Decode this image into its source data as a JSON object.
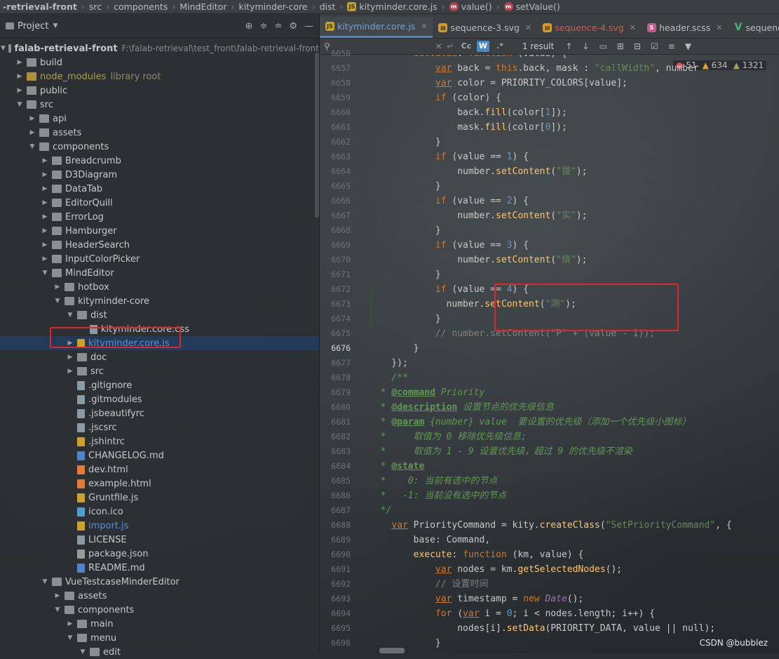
{
  "breadcrumb": [
    "-retrieval-front",
    "src",
    "components",
    "MindEditor",
    "kityminder-core",
    "dist",
    "kityminder.core.js",
    "value()",
    "setValue()"
  ],
  "project": {
    "title": "Project",
    "rows": [
      {
        "indent": 0,
        "arrow": "down",
        "icon": "folder",
        "label": "falab-retrieval-front",
        "path": "F:\\falab-retrieval\\test_front\\falab-retrieval-front",
        "bold": true
      },
      {
        "indent": 1,
        "arrow": "right",
        "icon": "folder",
        "label": "build"
      },
      {
        "indent": 1,
        "arrow": "right",
        "icon": "folder-lib",
        "label": "node_modules",
        "note": "library root",
        "style": "yellow"
      },
      {
        "indent": 1,
        "arrow": "right",
        "icon": "folder",
        "label": "public"
      },
      {
        "indent": 1,
        "arrow": "down",
        "icon": "folder",
        "label": "src"
      },
      {
        "indent": 2,
        "arrow": "right",
        "icon": "folder",
        "label": "api"
      },
      {
        "indent": 2,
        "arrow": "right",
        "icon": "folder",
        "label": "assets"
      },
      {
        "indent": 2,
        "arrow": "down",
        "icon": "folder",
        "label": "components"
      },
      {
        "indent": 3,
        "arrow": "right",
        "icon": "folder",
        "label": "Breadcrumb"
      },
      {
        "indent": 3,
        "arrow": "right",
        "icon": "folder",
        "label": "D3Diagram"
      },
      {
        "indent": 3,
        "arrow": "right",
        "icon": "folder",
        "label": "DataTab"
      },
      {
        "indent": 3,
        "arrow": "right",
        "icon": "folder",
        "label": "EditorQuill"
      },
      {
        "indent": 3,
        "arrow": "right",
        "icon": "folder",
        "label": "ErrorLog"
      },
      {
        "indent": 3,
        "arrow": "right",
        "icon": "folder",
        "label": "Hamburger"
      },
      {
        "indent": 3,
        "arrow": "right",
        "icon": "folder",
        "label": "HeaderSearch"
      },
      {
        "indent": 3,
        "arrow": "right",
        "icon": "folder",
        "label": "InputColorPicker"
      },
      {
        "indent": 3,
        "arrow": "down",
        "icon": "folder",
        "label": "MindEditor"
      },
      {
        "indent": 4,
        "arrow": "right",
        "icon": "folder",
        "label": "hotbox"
      },
      {
        "indent": 4,
        "arrow": "down",
        "icon": "folder",
        "label": "kityminder-core"
      },
      {
        "indent": 5,
        "arrow": "down",
        "icon": "folder",
        "label": "dist"
      },
      {
        "indent": 6,
        "arrow": "",
        "icon": "file",
        "label": "kityminder.core.css"
      },
      {
        "indent": 5,
        "arrow": "right",
        "icon": "file-js",
        "label": "kityminder.core.js",
        "selected": true,
        "style": "blue"
      },
      {
        "indent": 5,
        "arrow": "right",
        "icon": "folder",
        "label": "doc"
      },
      {
        "indent": 5,
        "arrow": "right",
        "icon": "folder",
        "label": "src"
      },
      {
        "indent": 5,
        "arrow": "",
        "icon": "file",
        "label": ".gitignore"
      },
      {
        "indent": 5,
        "arrow": "",
        "icon": "file",
        "label": ".gitmodules"
      },
      {
        "indent": 5,
        "arrow": "",
        "icon": "file",
        "label": ".jsbeautifyrc"
      },
      {
        "indent": 5,
        "arrow": "",
        "icon": "file",
        "label": ".jscsrc"
      },
      {
        "indent": 5,
        "arrow": "",
        "icon": "file-js",
        "label": ".jshintrc"
      },
      {
        "indent": 5,
        "arrow": "",
        "icon": "file-md",
        "label": "CHANGELOG.md"
      },
      {
        "indent": 5,
        "arrow": "",
        "icon": "file-html",
        "label": "dev.html"
      },
      {
        "indent": 5,
        "arrow": "",
        "icon": "file-html",
        "label": "example.html"
      },
      {
        "indent": 5,
        "arrow": "",
        "icon": "file-js",
        "label": "Gruntfile.js"
      },
      {
        "indent": 5,
        "arrow": "",
        "icon": "file-ico",
        "label": "icon.ico"
      },
      {
        "indent": 5,
        "arrow": "",
        "icon": "file-js",
        "label": "import.js",
        "style": "blue"
      },
      {
        "indent": 5,
        "arrow": "",
        "icon": "file",
        "label": "LICENSE"
      },
      {
        "indent": 5,
        "arrow": "",
        "icon": "file-json",
        "label": "package.json"
      },
      {
        "indent": 5,
        "arrow": "",
        "icon": "file-md",
        "label": "README.md"
      },
      {
        "indent": 3,
        "arrow": "down",
        "icon": "folder",
        "label": "VueTestcaseMinderEditor"
      },
      {
        "indent": 4,
        "arrow": "right",
        "icon": "folder",
        "label": "assets"
      },
      {
        "indent": 4,
        "arrow": "down",
        "icon": "folder",
        "label": "components"
      },
      {
        "indent": 5,
        "arrow": "right",
        "icon": "folder",
        "label": "main"
      },
      {
        "indent": 5,
        "arrow": "down",
        "icon": "folder",
        "label": "menu"
      },
      {
        "indent": 6,
        "arrow": "down",
        "icon": "folder",
        "label": "edit"
      }
    ]
  },
  "tabs": [
    {
      "label": "kityminder.core.js",
      "badge": "JS",
      "active": true
    },
    {
      "label": "sequence-3.svg",
      "badge": "svg"
    },
    {
      "label": "sequence-4.svg",
      "badge": "svg",
      "red": true
    },
    {
      "label": "header.scss",
      "badge": "sass"
    },
    {
      "label": "sequenceBox",
      "badge": "vue"
    }
  ],
  "search": {
    "results": "1 result",
    "word_toggle": "W",
    "case_toggle": "Cc"
  },
  "inspections": {
    "errors": "51",
    "warnings": "634",
    "weak": "1321"
  },
  "editor": {
    "first_line": 6656,
    "current_line": 6676,
    "lines": [
      [
        [
          "kw",
          "        setValue"
        ],
        [
          "",
          ": "
        ],
        [
          "kw",
          "function"
        ],
        [
          "",
          " (value) {"
        ]
      ],
      [
        [
          "",
          "            "
        ],
        [
          "vr",
          "var"
        ],
        [
          "",
          " back = "
        ],
        [
          "kw",
          "this"
        ],
        [
          "",
          ".back, mask : "
        ],
        [
          "str",
          "\"callWidth\""
        ],
        [
          "",
          ", number"
        ]
      ],
      [
        [
          "",
          "            "
        ],
        [
          "vr",
          "var"
        ],
        [
          "",
          " color = PRIORITY_COLORS[value];"
        ]
      ],
      [
        [
          "",
          "            "
        ],
        [
          "kw",
          "if"
        ],
        [
          "",
          " (color) {"
        ]
      ],
      [
        [
          "",
          "                back."
        ],
        [
          "fn",
          "fill"
        ],
        [
          "",
          "(color["
        ],
        [
          "num",
          "1"
        ],
        [
          "",
          "]);"
        ]
      ],
      [
        [
          "",
          "                mask."
        ],
        [
          "fn",
          "fill"
        ],
        [
          "",
          "(color["
        ],
        [
          "num",
          "0"
        ],
        [
          "",
          "]);"
        ]
      ],
      [
        [
          "",
          "            }"
        ]
      ],
      [
        [
          "",
          "            "
        ],
        [
          "kw",
          "if"
        ],
        [
          "",
          " (value == "
        ],
        [
          "num",
          "1"
        ],
        [
          "",
          ") {"
        ]
      ],
      [
        [
          "",
          "                number."
        ],
        [
          "fn",
          "setContent"
        ],
        [
          "",
          "("
        ],
        [
          "str",
          "\"拔\""
        ],
        [
          "",
          ");"
        ]
      ],
      [
        [
          "",
          "            }"
        ]
      ],
      [
        [
          "",
          "            "
        ],
        [
          "kw",
          "if"
        ],
        [
          "",
          " (value == "
        ],
        [
          "num",
          "2"
        ],
        [
          "",
          ") {"
        ]
      ],
      [
        [
          "",
          "                number."
        ],
        [
          "fn",
          "setContent"
        ],
        [
          "",
          "("
        ],
        [
          "str",
          "\"实\""
        ],
        [
          "",
          ");"
        ]
      ],
      [
        [
          "",
          "            }"
        ]
      ],
      [
        [
          "",
          "            "
        ],
        [
          "kw",
          "if"
        ],
        [
          "",
          " (value == "
        ],
        [
          "num",
          "3"
        ],
        [
          "",
          ") {"
        ]
      ],
      [
        [
          "",
          "                number."
        ],
        [
          "fn",
          "setContent"
        ],
        [
          "",
          "("
        ],
        [
          "str",
          "\"烧\""
        ],
        [
          "",
          ");"
        ]
      ],
      [
        [
          "",
          "            }"
        ]
      ],
      [
        [
          "",
          "            "
        ],
        [
          "kw",
          "if"
        ],
        [
          "",
          " (value == "
        ],
        [
          "num",
          "4"
        ],
        [
          "",
          ") {"
        ]
      ],
      [
        [
          "",
          "              number."
        ],
        [
          "fn",
          "setContent"
        ],
        [
          "",
          "("
        ],
        [
          "str",
          "\"测\""
        ],
        [
          "",
          ");"
        ]
      ],
      [
        [
          "",
          "            }"
        ]
      ],
      [
        [
          "cm",
          "            // number.setContent(\"P\" + (value - 1));"
        ]
      ],
      [
        [
          "",
          "        }"
        ]
      ],
      [
        [
          "",
          "    });"
        ]
      ],
      [
        [
          "doc",
          "    /**"
        ]
      ],
      [
        [
          "doc",
          "  * "
        ],
        [
          "tag",
          "@command"
        ],
        [
          "doc",
          " Priority"
        ]
      ],
      [
        [
          "doc",
          "  * "
        ],
        [
          "tag",
          "@description"
        ],
        [
          "doc",
          " 设置节点的优先级信息"
        ]
      ],
      [
        [
          "doc",
          "  * "
        ],
        [
          "tag",
          "@param"
        ],
        [
          "doc",
          " {number} value  要设置的优先级（添加一个优先级小图标）"
        ]
      ],
      [
        [
          "doc",
          "  *     取值为 0 移除优先级信息;"
        ]
      ],
      [
        [
          "doc",
          "  *     取值为 1 - 9 设置优先级，超过 9 的优先级不渲染"
        ]
      ],
      [
        [
          "doc",
          "  * "
        ],
        [
          "tag",
          "@state"
        ]
      ],
      [
        [
          "doc",
          "  *    0: 当前有选中的节点"
        ]
      ],
      [
        [
          "doc",
          "  *   -1: 当前没有选中的节点"
        ]
      ],
      [
        [
          "doc",
          "  */"
        ]
      ],
      [
        [
          "",
          "    "
        ],
        [
          "vr",
          "var"
        ],
        [
          "",
          " PriorityCommand = kity."
        ],
        [
          "fn",
          "createClass"
        ],
        [
          "",
          "("
        ],
        [
          "str",
          "\"SetPriorityCommand\""
        ],
        [
          "",
          ", {"
        ]
      ],
      [
        [
          "",
          "        base: Command,"
        ]
      ],
      [
        [
          "",
          "        "
        ],
        [
          "fn",
          "execute"
        ],
        [
          "",
          ": "
        ],
        [
          "kw",
          "function"
        ],
        [
          "",
          " (km, value) {"
        ]
      ],
      [
        [
          "",
          "            "
        ],
        [
          "vr",
          "var"
        ],
        [
          "",
          " nodes = km."
        ],
        [
          "fn",
          "getSelectedNodes"
        ],
        [
          "",
          "();"
        ]
      ],
      [
        [
          "cm",
          "            // 设置时间"
        ]
      ],
      [
        [
          "",
          "            "
        ],
        [
          "vr",
          "var"
        ],
        [
          "",
          " timestamp = "
        ],
        [
          "kw",
          "new"
        ],
        [
          "",
          " "
        ],
        [
          "cls",
          "Date"
        ],
        [
          "",
          "();"
        ]
      ],
      [
        [
          "",
          "            "
        ],
        [
          "kw",
          "for"
        ],
        [
          "",
          " ("
        ],
        [
          "vr",
          "var"
        ],
        [
          "",
          " i = "
        ],
        [
          "num",
          "0"
        ],
        [
          "",
          "; i < nodes.length; i++) {"
        ]
      ],
      [
        [
          "",
          "                nodes[i]."
        ],
        [
          "fn",
          "setData"
        ],
        [
          "",
          "(PRIORITY_DATA, value || null);"
        ]
      ],
      [
        [
          "",
          "            }"
        ]
      ]
    ]
  },
  "watermark": "CSDN @bubblez"
}
